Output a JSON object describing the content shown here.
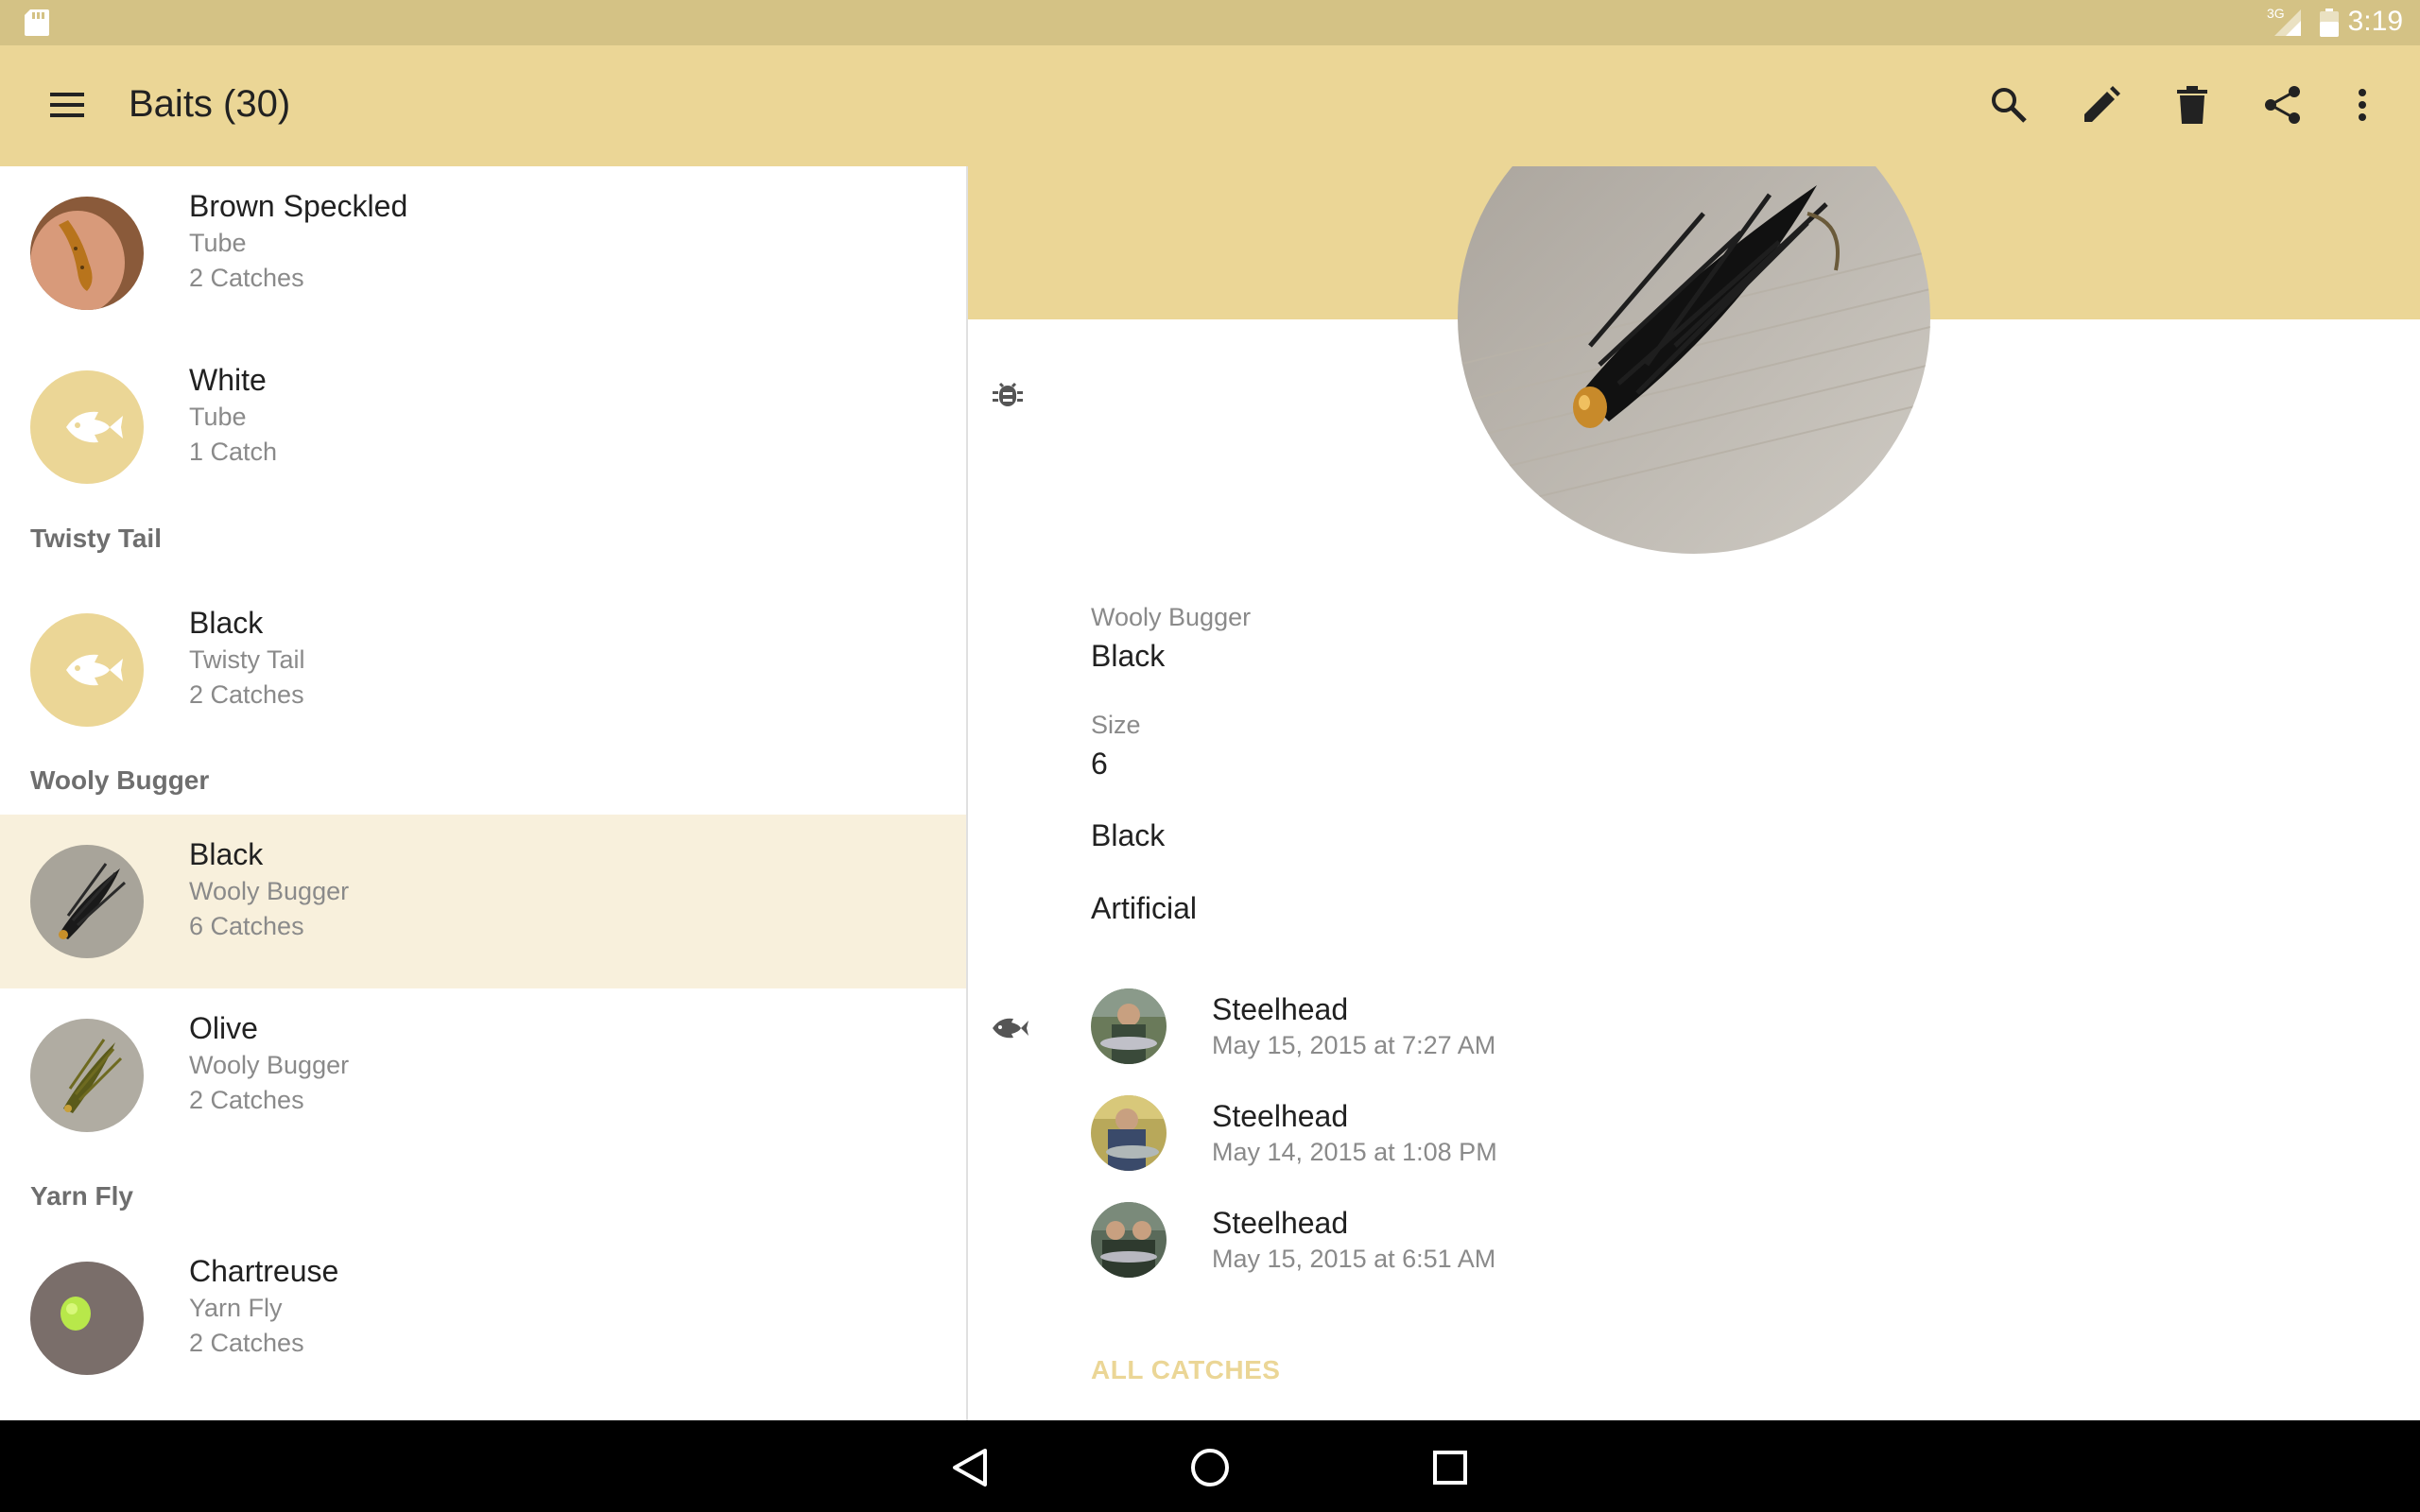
{
  "status_bar": {
    "time": "3:19",
    "network": "3G"
  },
  "toolbar": {
    "title": "Baits (30)"
  },
  "list": {
    "rows": [
      {
        "name": "Brown Speckled",
        "type": "Tube",
        "catches": "2 Catches"
      },
      {
        "name": "White",
        "type": "Tube",
        "catches": "1 Catch"
      },
      {
        "name": "Black",
        "type": "Twisty Tail",
        "catches": "2 Catches"
      },
      {
        "name": "Black",
        "type": "Wooly Bugger",
        "catches": "6 Catches"
      },
      {
        "name": "Olive",
        "type": "Wooly Bugger",
        "catches": "2 Catches"
      },
      {
        "name": "Chartreuse",
        "type": "Yarn Fly",
        "catches": "2 Catches"
      }
    ],
    "headers": [
      "Twisty Tail",
      "Wooly Bugger",
      "Yarn Fly"
    ]
  },
  "detail": {
    "category": "Wooly Bugger",
    "name": "Black",
    "size_label": "Size",
    "size_value": "6",
    "color": "Black",
    "bait_type": "Artificial",
    "catches": [
      {
        "species": "Steelhead",
        "date": "May 15, 2015 at 7:27 AM"
      },
      {
        "species": "Steelhead",
        "date": "May 14, 2015 at 1:08 PM"
      },
      {
        "species": "Steelhead",
        "date": "May 15, 2015 at 6:51 AM"
      }
    ],
    "all_catches_label": "ALL CATCHES"
  },
  "colors": {
    "status_bar": "#d4c285",
    "toolbar": "#ebd696",
    "accent": "#ebd696",
    "selected_row": "#f8f0dc"
  }
}
